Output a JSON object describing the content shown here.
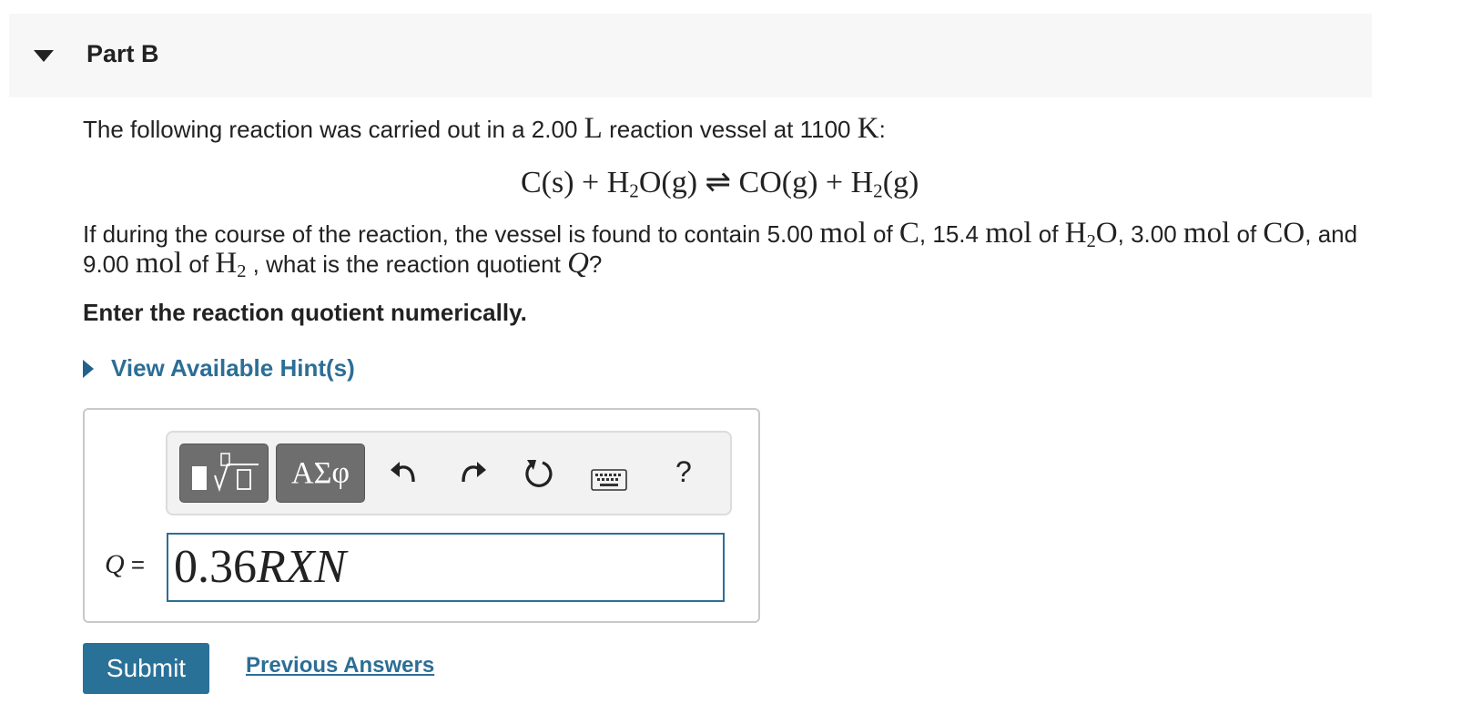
{
  "part": {
    "title": "Part B"
  },
  "problem": {
    "intro_text": "The following reaction was carried out in a 2.00",
    "volume_unit": "L",
    "intro_text_2": "reaction vessel at 1100",
    "temperature_unit": "K",
    "colon": ":",
    "equation": {
      "reactant1": "C(s) + H",
      "reactant2_sub": "2",
      "reactant2_rest": "O(g)",
      "arrow": "⇌",
      "product1": "CO(g) + H",
      "product2_sub": "2",
      "product2_rest": "(g)"
    },
    "question": {
      "t1": "If during the course of the reaction, the vessel is found to contain 5.00",
      "mol1": "mol",
      "t2": "of",
      "s1": "C",
      "t3": ", 15.4",
      "mol2": "mol",
      "t4": "of",
      "s2a": "H",
      "s2sub": "2",
      "s2b": "O",
      "t5": ", 3.00",
      "mol3": "mol",
      "t6": "of",
      "s3": "CO",
      "t7": ", and 9.00",
      "mol4": "mol",
      "t8": "of",
      "s4a": "H",
      "s4sub": "2",
      "t9": ", what is the reaction quotient",
      "q": "Q",
      "qmark": "?"
    },
    "instruction": "Enter the reaction quotient numerically."
  },
  "hints": {
    "label": "View Available Hint(s)"
  },
  "toolbar": {
    "greek_label": "ΑΣφ",
    "help_label": "?",
    "icons": [
      "templates-icon",
      "greek-letters-icon",
      "undo-icon",
      "redo-icon",
      "reset-icon",
      "keyboard-icon",
      "help-icon"
    ]
  },
  "answer": {
    "label_var": "Q",
    "label_eq": "=",
    "value_number": "0.36",
    "value_var": "RXN"
  },
  "actions": {
    "submit_label": "Submit",
    "previous_answers_label": "Previous Answers"
  },
  "colors": {
    "accent": "#2c6e96",
    "submit_bg": "#2a7197",
    "header_bg": "#f7f7f7",
    "toolbar_button_bg": "#6e6e6e"
  }
}
